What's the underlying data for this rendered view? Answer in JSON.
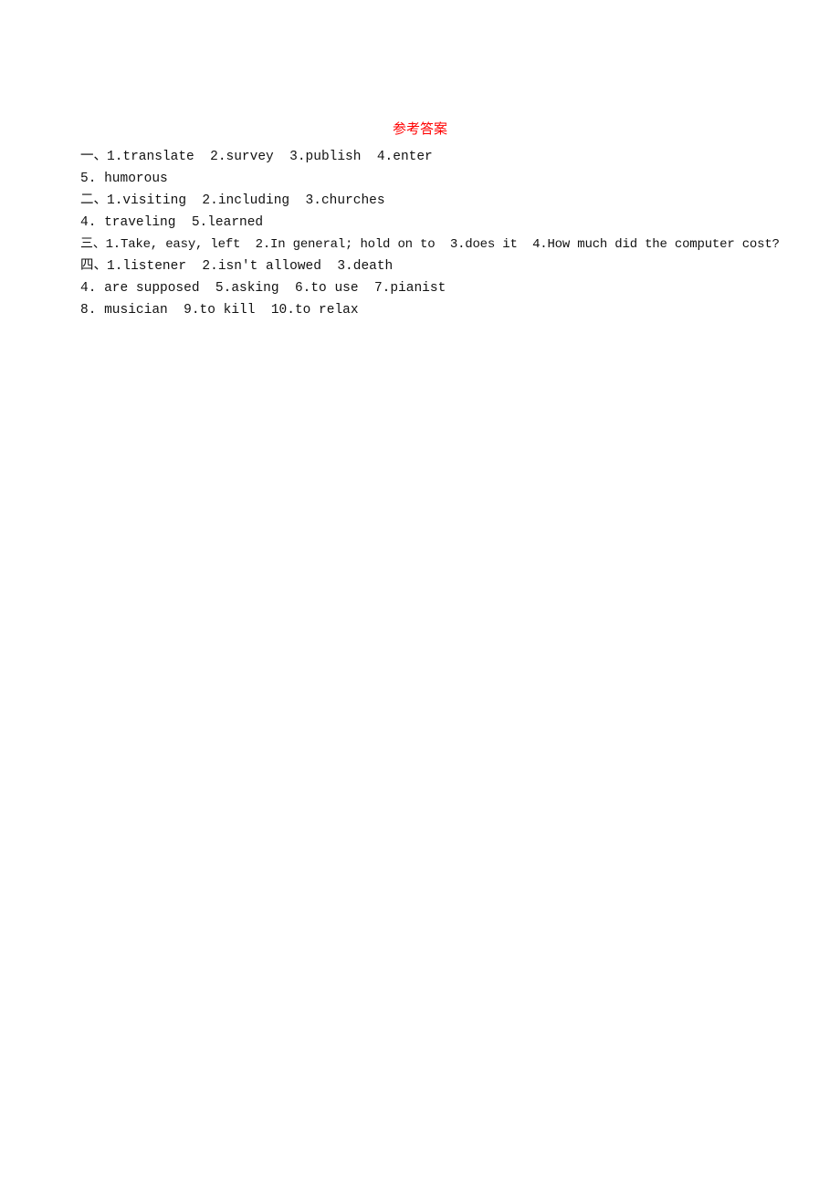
{
  "document": {
    "title": "参考答案",
    "lines": [
      "一、1.translate  2.survey  3.publish  4.enter",
      "5. humorous",
      "二、1.visiting  2.including  3.churches",
      "4. traveling  5.learned",
      "三、1.Take, easy, left  2.In general; hold on to  3.does it  4.How much did the computer cost?",
      "四、1.listener  2.isn't allowed  3.death",
      "4. are supposed  5.asking  6.to use  7.pianist",
      "8. musician  9.to kill  10.to relax"
    ],
    "colors": {
      "title": "#ff0000",
      "text": "#111111"
    }
  }
}
